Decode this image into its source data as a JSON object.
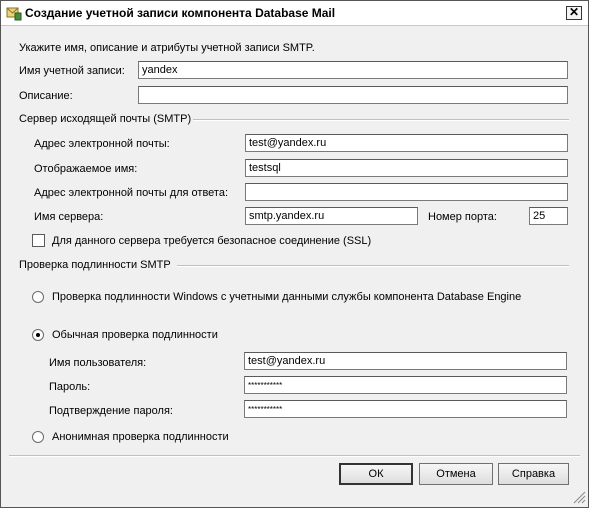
{
  "window": {
    "title": "Создание учетной записи компонента Database Mail",
    "close_label": "✕"
  },
  "intro": "Укажите имя, описание и атрибуты учетной записи SMTP.",
  "account": {
    "name_label": "Имя учетной записи:",
    "name_value": "yandex",
    "desc_label": "Описание:",
    "desc_value": ""
  },
  "smtp": {
    "group_label": "Сервер исходящей почты (SMTP)",
    "email_label": "Адрес электронной почты:",
    "email_value": "test@yandex.ru",
    "display_label": "Отображаемое имя:",
    "display_value": "testsql",
    "reply_label": "Адрес электронной почты для ответа:",
    "reply_value": "",
    "server_label": "Имя сервера:",
    "server_value": "smtp.yandex.ru",
    "port_label": "Номер порта:",
    "port_value": "25",
    "ssl_label": "Для данного сервера требуется безопасное соединение (SSL)",
    "ssl_checked": false
  },
  "auth": {
    "group_label": "Проверка подлинности SMTP",
    "windows_label": "Проверка подлинности Windows с учетными данными службы компонента Database Engine",
    "basic_label": "Обычная проверка подлинности",
    "selected": "basic",
    "user_label": "Имя пользователя:",
    "user_value": "test@yandex.ru",
    "pass_label": "Пароль:",
    "pass_value": "***********",
    "confirm_label": "Подтверждение пароля:",
    "confirm_value": "***********",
    "anon_label": "Анонимная проверка подлинности"
  },
  "buttons": {
    "ok": "ОК",
    "cancel": "Отмена",
    "help": "Справка"
  }
}
